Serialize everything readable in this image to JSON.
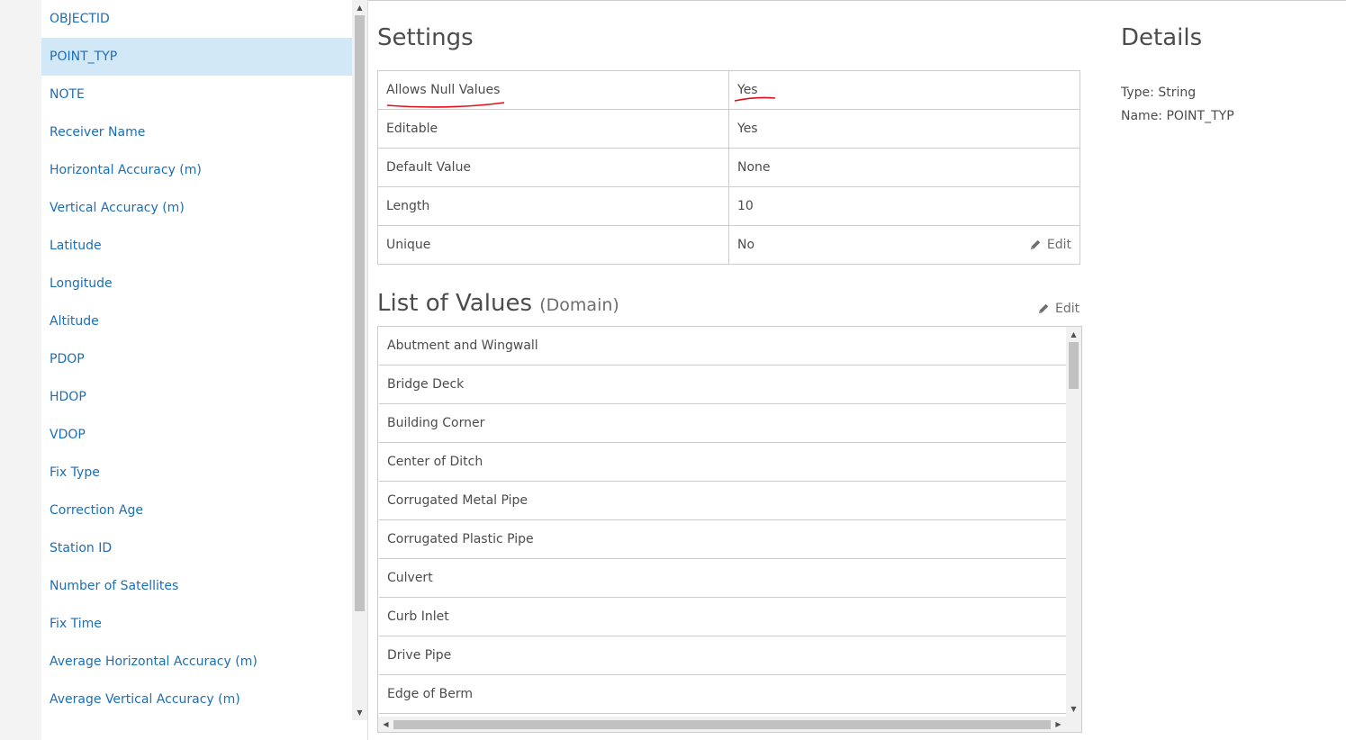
{
  "fields": [
    "OBJECTID",
    "POINT_TYP",
    "NOTE",
    "Receiver Name",
    "Horizontal Accuracy (m)",
    "Vertical Accuracy (m)",
    "Latitude",
    "Longitude",
    "Altitude",
    "PDOP",
    "HDOP",
    "VDOP",
    "Fix Type",
    "Correction Age",
    "Station ID",
    "Number of Satellites",
    "Fix Time",
    "Average Horizontal Accuracy (m)",
    "Average Vertical Accuracy (m)"
  ],
  "selected_field": "POINT_TYP",
  "settings": {
    "title": "Settings",
    "rows": [
      {
        "label": "Allows Null Values",
        "value": "Yes"
      },
      {
        "label": "Editable",
        "value": "Yes"
      },
      {
        "label": "Default Value",
        "value": "None"
      },
      {
        "label": "Length",
        "value": "10"
      },
      {
        "label": "Unique",
        "value": "No"
      }
    ],
    "edit_label": "Edit"
  },
  "list_of_values": {
    "title": "List of Values",
    "subtitle": "(Domain)",
    "edit_label": "Edit",
    "items": [
      "Abutment and Wingwall",
      "Bridge Deck",
      "Building Corner",
      "Center of Ditch",
      "Corrugated Metal Pipe",
      "Corrugated Plastic Pipe",
      "Culvert",
      "Curb Inlet",
      "Drive Pipe",
      "Edge of Berm"
    ]
  },
  "details": {
    "title": "Details",
    "type_line": "Type: String",
    "name_line": "Name: POINT_TYP"
  },
  "annotation_color": "#e0101a",
  "accent_color": "#1c6eb5",
  "selected_bg": "#d3e8f7",
  "icons": {
    "edit": "pencil-icon",
    "scroll_up": "triangle-up",
    "scroll_down": "triangle-down"
  }
}
